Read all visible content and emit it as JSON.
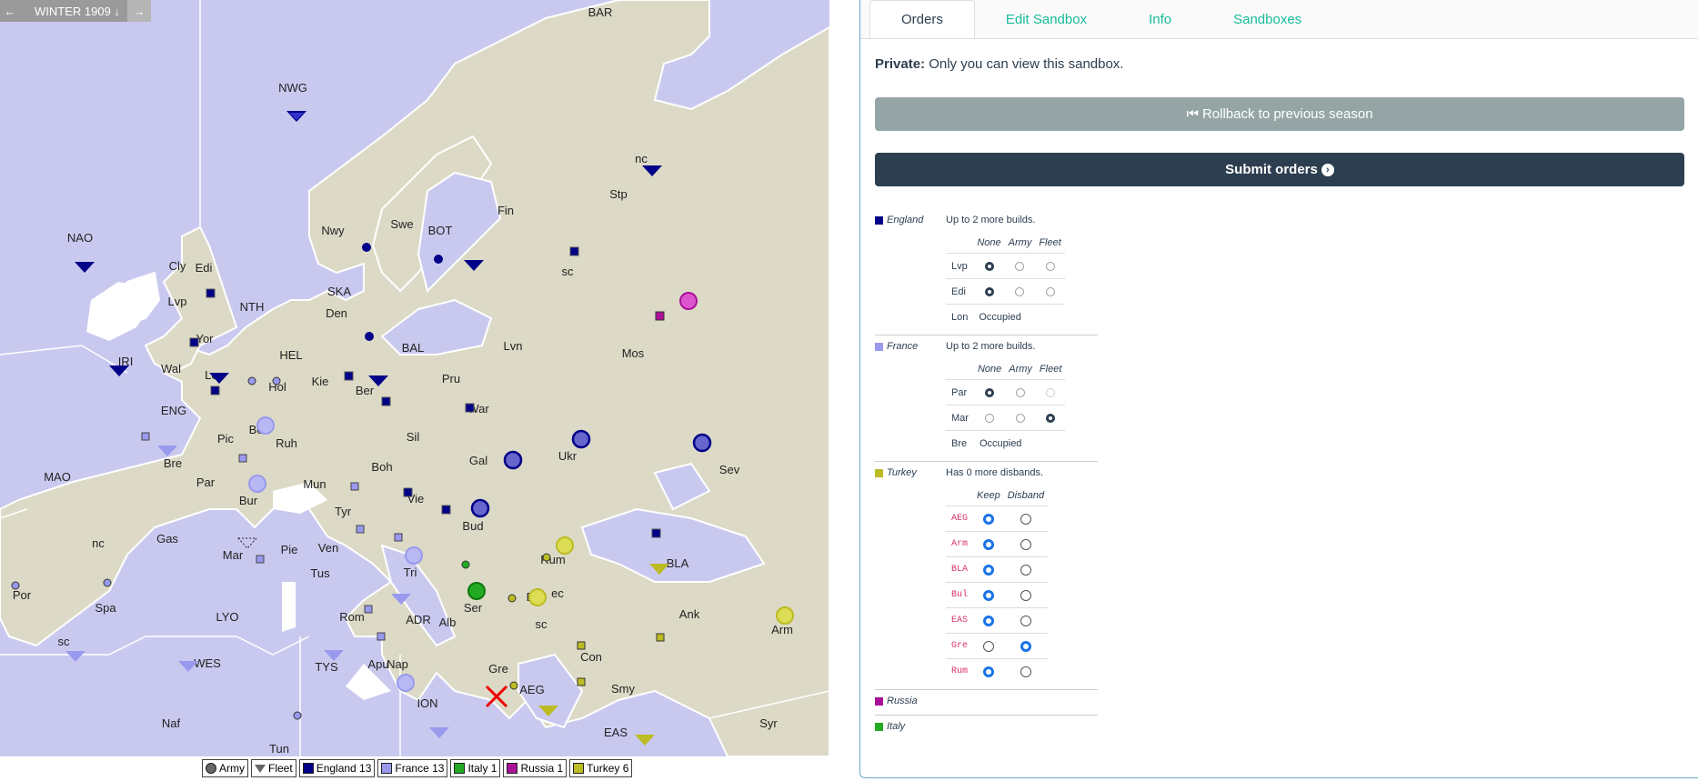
{
  "map": {
    "season": "WINTER 1909",
    "nav_prev": "←",
    "nav_down": "↓",
    "nav_next": "→",
    "labels": [
      "BAR",
      "NWG",
      "NAO",
      "Cly",
      "Edi",
      "Lvp",
      "Yor",
      "NTH",
      "IRI",
      "Wal",
      "Lon",
      "ENG",
      "HEL",
      "Hol",
      "Kie",
      "Ber",
      "Den",
      "SKA",
      "Nwy",
      "Swe",
      "BOT",
      "Fin",
      "Stp",
      "nc",
      "sc",
      "Mos",
      "Lvn",
      "BAL",
      "Pru",
      "War",
      "Sil",
      "Ruh",
      "Bel",
      "Pic",
      "Bre",
      "Par",
      "Bur",
      "Mun",
      "Boh",
      "Gal",
      "Ukr",
      "Sev",
      "Vie",
      "Bud",
      "Rum",
      "Tyr",
      "Tri",
      "Ser",
      "Bul",
      "ec",
      "sc",
      "BLA",
      "Ank",
      "Arm",
      "Con",
      "Smy",
      "Syr",
      "EAS",
      "AEG",
      "Gre",
      "Alb",
      "ADR",
      "Apu",
      "Rom",
      "Nap",
      "TYS",
      "ION",
      "WES",
      "LYO",
      "Tus",
      "Ven",
      "Pie",
      "Mar",
      "Gas",
      "Spa",
      "nc",
      "sc",
      "Por",
      "MAO",
      "Naf",
      "Tun"
    ],
    "legend": [
      {
        "label": "Army",
        "color": "#666666"
      },
      {
        "label": "Fleet",
        "color": "#666666"
      },
      {
        "label": "England 13",
        "color": "#000088"
      },
      {
        "label": "France 13",
        "color": "#9999ee"
      },
      {
        "label": "Italy 1",
        "color": "#22aa22"
      },
      {
        "label": "Russia 1",
        "color": "#aa1199"
      },
      {
        "label": "Turkey 6",
        "color": "#bbbb22"
      }
    ],
    "colors": {
      "sea": "#c9c9f0",
      "land": "#dcdac6",
      "border": "#ffffff",
      "england": "#000088",
      "france": "#9999ee",
      "italy": "#22aa22",
      "russia": "#aa1199",
      "turkey": "#bbbb22"
    }
  },
  "tabs": [
    {
      "label": "Orders",
      "active": true
    },
    {
      "label": "Edit Sandbox"
    },
    {
      "label": "Info"
    },
    {
      "label": "Sandboxes"
    }
  ],
  "private": {
    "bold": "Private:",
    "text": " Only you can view this sandbox."
  },
  "buttons": {
    "rollback": "Rollback to previous season",
    "submit": "Submit orders"
  },
  "nations": {
    "england": {
      "name": "England",
      "msg": "Up to 2 more builds.",
      "cols": [
        "None",
        "Army",
        "Fleet"
      ],
      "rows": [
        {
          "prov": "Lvp",
          "sel": 0
        },
        {
          "prov": "Edi",
          "sel": 0
        },
        {
          "prov": "Lon",
          "status": "Occupied"
        }
      ]
    },
    "france": {
      "name": "France",
      "msg": "Up to 2 more builds.",
      "cols": [
        "None",
        "Army",
        "Fleet"
      ],
      "rows": [
        {
          "prov": "Par",
          "sel": 0
        },
        {
          "prov": "Mar",
          "sel": 2
        },
        {
          "prov": "Bre",
          "status": "Occupied"
        }
      ]
    },
    "turkey": {
      "name": "Turkey",
      "msg": "Has 0 more disbands.",
      "cols": [
        "Keep",
        "Disband"
      ],
      "rows": [
        {
          "prov": "AEG",
          "sel": 0
        },
        {
          "prov": "Arm",
          "sel": 0
        },
        {
          "prov": "BLA",
          "sel": 0
        },
        {
          "prov": "Bul",
          "sel": 0
        },
        {
          "prov": "EAS",
          "sel": 0
        },
        {
          "prov": "Gre",
          "sel": 1
        },
        {
          "prov": "Rum",
          "sel": 0
        }
      ]
    },
    "russia": {
      "name": "Russia"
    },
    "italy": {
      "name": "Italy"
    }
  }
}
